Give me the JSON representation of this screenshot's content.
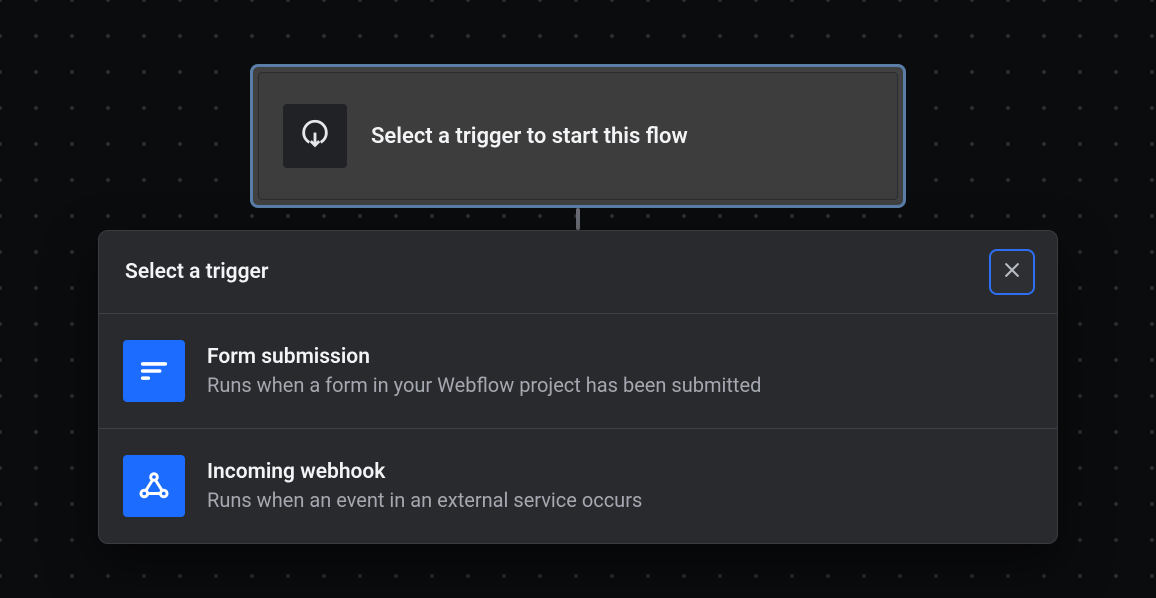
{
  "trigger_node": {
    "label": "Select a trigger to start this flow"
  },
  "picker": {
    "title": "Select a trigger",
    "options": [
      {
        "title": "Form submission",
        "description": "Runs when a form in your Webflow project has been submitted",
        "icon": "form-icon"
      },
      {
        "title": "Incoming webhook",
        "description": "Runs when an event in an external service occurs",
        "icon": "webhook-icon"
      }
    ]
  }
}
